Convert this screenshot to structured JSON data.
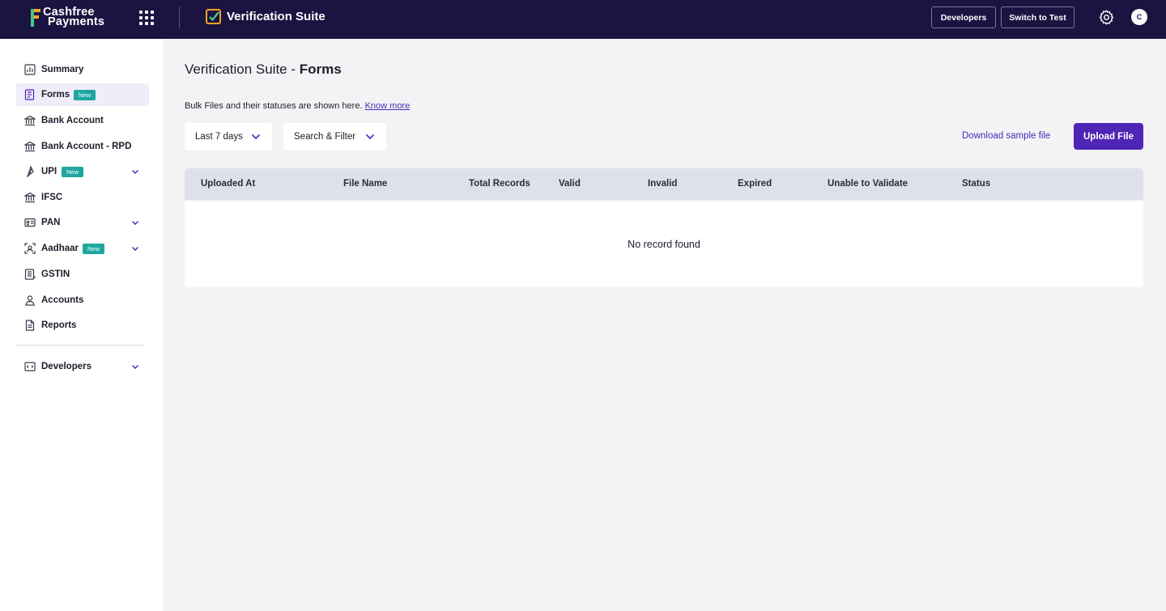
{
  "header": {
    "brand_line1": "Cashfree",
    "brand_line2": "Payments",
    "product_name": "Verification Suite",
    "developers_label": "Developers",
    "switch_label": "Switch to Test",
    "avatar_initial": "C",
    "brand_color": "#1b1340",
    "accent_color": "#4f25b5"
  },
  "sidebar": {
    "items": [
      {
        "label": "Summary",
        "icon": "chart-icon"
      },
      {
        "label": "Forms",
        "icon": "form-icon",
        "badge": "New",
        "active": true
      },
      {
        "label": "Bank Account",
        "icon": "bank-icon"
      },
      {
        "label": "Bank Account - RPD",
        "icon": "bank-icon"
      },
      {
        "label": "UPI",
        "icon": "upi-icon",
        "badge": "New",
        "expandable": true
      },
      {
        "label": "IFSC",
        "icon": "bank-icon"
      },
      {
        "label": "PAN",
        "icon": "id-card-icon",
        "expandable": true
      },
      {
        "label": "Aadhaar",
        "icon": "scan-icon",
        "badge": "New",
        "expandable": true
      },
      {
        "label": "GSTIN",
        "icon": "document-icon"
      },
      {
        "label": "Accounts",
        "icon": "user-icon"
      },
      {
        "label": "Reports",
        "icon": "report-icon"
      },
      {
        "label": "Developers",
        "icon": "code-icon",
        "expandable": true
      }
    ]
  },
  "main": {
    "title_prefix": "Verification Suite - ",
    "title_bold": "Forms",
    "description": "Bulk Files and their statuses are shown here.",
    "know_more": "Know more",
    "date_filter": "Last 7 days",
    "search_filter": "Search & Filter",
    "download_sample": "Download sample file",
    "upload_button": "Upload File",
    "table": {
      "columns": [
        "Uploaded At",
        "File Name",
        "Total Records",
        "Valid",
        "Invalid",
        "Expired",
        "Unable to Validate",
        "Status"
      ],
      "empty_message": "No record found"
    }
  }
}
